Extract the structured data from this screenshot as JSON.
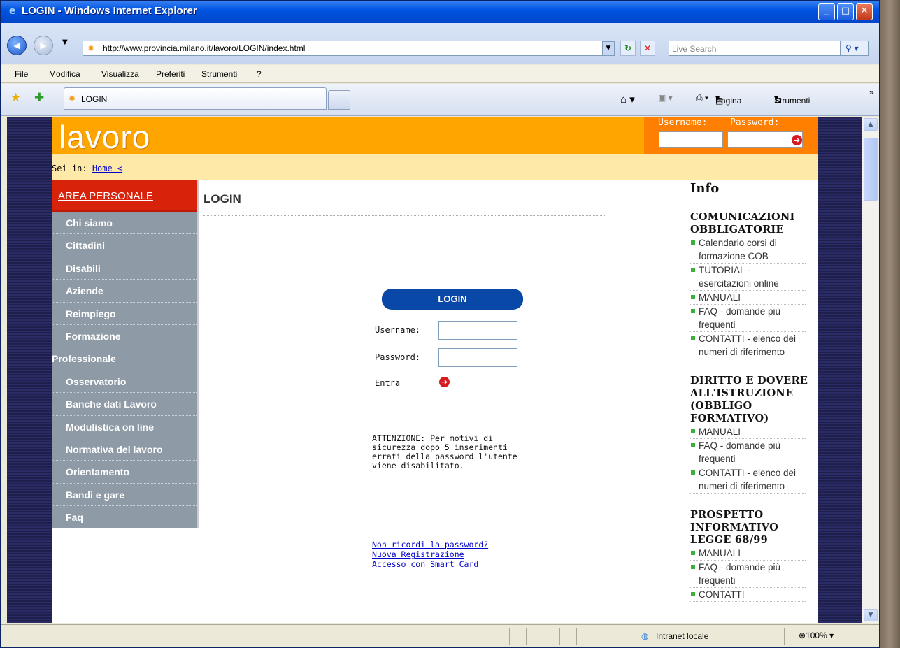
{
  "window": {
    "title": "LOGIN - Windows Internet Explorer"
  },
  "address": {
    "url": "http://www.provincia.milano.it/lavoro/LOGIN/index.html",
    "search_placeholder": "Live Search"
  },
  "menu": [
    "File",
    "Modifica",
    "Visualizza",
    "Preferiti",
    "Strumenti",
    "?"
  ],
  "tab": {
    "title": "LOGIN"
  },
  "toolbar": {
    "page_label": "Pagina",
    "tools_label": "Strumenti"
  },
  "site": {
    "logo": "lavoro",
    "login_box": {
      "username_label": "Username:",
      "password_label": "Password:"
    },
    "breadcrumb": {
      "prefix": "Sei in:",
      "home": "Home <"
    },
    "sidebar": {
      "area": "AREA PERSONALE",
      "items": [
        "Chi siamo",
        "Cittadini",
        "Disabili",
        "Aziende",
        "Reimpiego",
        "Formazione",
        "Professionale",
        "Osservatorio",
        "Banche dati Lavoro",
        "Modulistica on line",
        "Normativa del lavoro",
        "Orientamento",
        "Bandi e gare",
        "Faq"
      ]
    },
    "main": {
      "title": "LOGIN",
      "form_header": "LOGIN",
      "username_label": "Username:",
      "password_label": "Password:",
      "enter_label": "Entra",
      "warning": "ATTENZIONE: Per motivi di sicurezza dopo 5 inserimenti errati della password l'utente viene disabilitato.",
      "links": [
        "Non ricordi la password?",
        "Nuova Registrazione",
        "Accesso con Smart Card"
      ]
    },
    "info": {
      "title": "Info",
      "sections": [
        {
          "heading": "COMUNICAZIONI OBBLIGATORIE",
          "items": [
            "Calendario corsi di formazione COB",
            "TUTORIAL - esercitazioni online",
            "MANUALI",
            "FAQ - domande più frequenti",
            "CONTATTI - elenco dei numeri di riferimento"
          ]
        },
        {
          "heading": "DIRITTO E DOVERE ALL'ISTRUZIONE (OBBLIGO FORMATIVO)",
          "items": [
            "MANUALI",
            "FAQ - domande più frequenti",
            "CONTATTI - elenco dei numeri di riferimento"
          ]
        },
        {
          "heading": "PROSPETTO INFORMATIVO LEGGE 68/99",
          "items": [
            "MANUALI",
            "FAQ - domande più frequenti",
            "CONTATTI"
          ]
        }
      ]
    }
  },
  "status": {
    "zone": "Intranet locale",
    "zoom": "100%"
  }
}
